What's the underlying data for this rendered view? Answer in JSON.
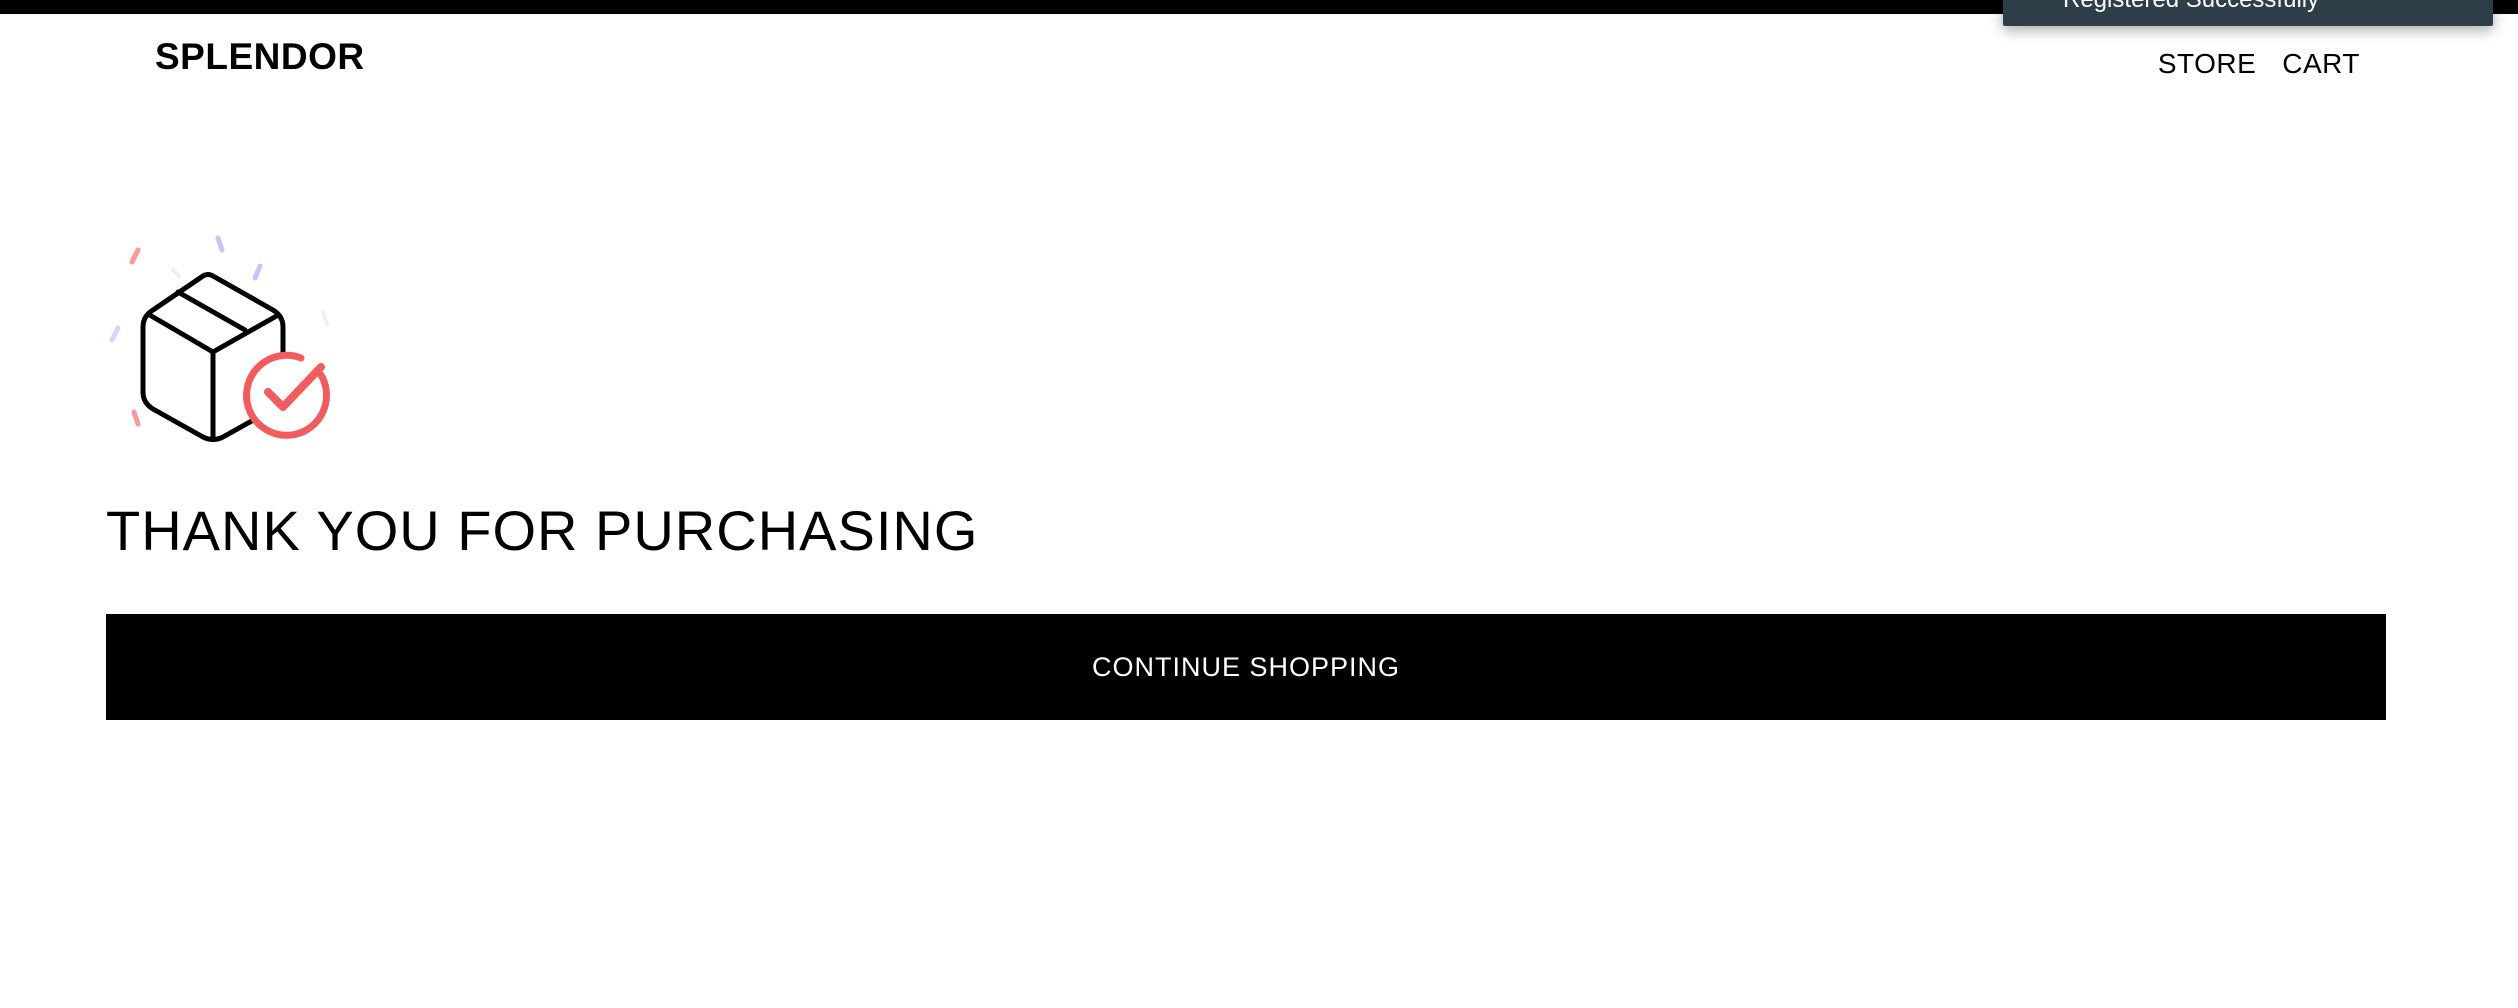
{
  "header": {
    "brand": "SPLENDOR",
    "nav": [
      {
        "label": "STORE"
      },
      {
        "label": "CART"
      }
    ]
  },
  "notification": {
    "text": "Registered Successfully"
  },
  "main": {
    "illustration_icon": "package-delivered-check-icon",
    "heading": "THANK YOU FOR PURCHASING",
    "continue_label": "CONTINUE SHOPPING"
  },
  "colors": {
    "topbar": "#000000",
    "toast_background": "#2f3f4a",
    "accent_check": "#f25c5f",
    "confetti_purple": "#c9c3f5",
    "confetti_pink": "#f59aa0",
    "button_background": "#000000",
    "button_text": "#ffffff"
  }
}
